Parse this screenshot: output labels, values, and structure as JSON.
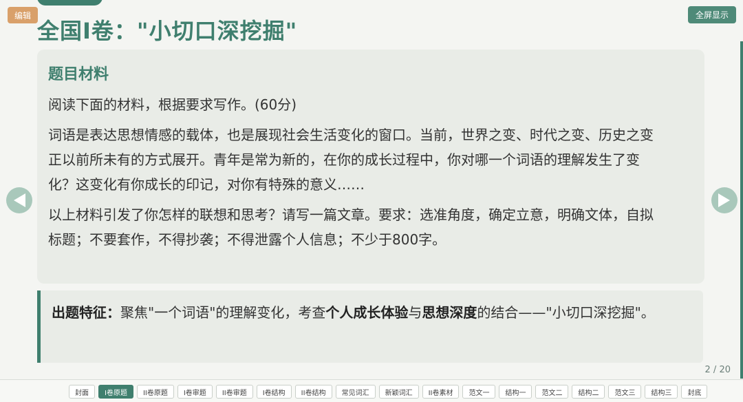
{
  "toolbar": {
    "edit_label": "编辑",
    "fullscreen_label": "全屏显示"
  },
  "page": {
    "title": "全国I卷：\"小切口深挖掘\"",
    "counter": "2 / 20"
  },
  "material": {
    "heading": "题目材料",
    "p1": "阅读下面的材料，根据要求写作。(60分)",
    "p2": "词语是表达思想情感的载体，也是展现社会生活变化的窗口。当前，世界之变、时代之变、历史之变正以前所未有的方式展开。青年是常为新的，在你的成长过程中，你对哪一个词语的理解发生了变化？这变化有你成长的印记，对你有特殊的意义……",
    "p3": "以上材料引发了你怎样的联想和思考？请写一篇文章。要求：选准角度，确定立意，明确文体，自拟标题；不要套作，不得抄袭；不得泄露个人信息；不少于800字。"
  },
  "feature": {
    "label": "出题特征：",
    "text1": "聚焦\"一个词语\"的理解变化，考查",
    "bold1": "个人成长体验",
    "text2": "与",
    "bold2": "思想深度",
    "text3": "的结合——\"小切口深挖掘\"。"
  },
  "tabs": [
    "封面",
    "I卷原题",
    "II卷原题",
    "I卷审题",
    "II卷审题",
    "I卷结构",
    "II卷结构",
    "常见词汇",
    "新颖词汇",
    "II卷素材",
    "范文一",
    "结构一",
    "范文二",
    "结构二",
    "范文三",
    "结构三",
    "封底"
  ],
  "active_tab": "I卷原题",
  "colors": {
    "accent": "#3f7f6e",
    "edit_button": "#d9a06a"
  },
  "icons": {
    "prev": "chevron-left-icon",
    "next": "chevron-right-icon"
  }
}
